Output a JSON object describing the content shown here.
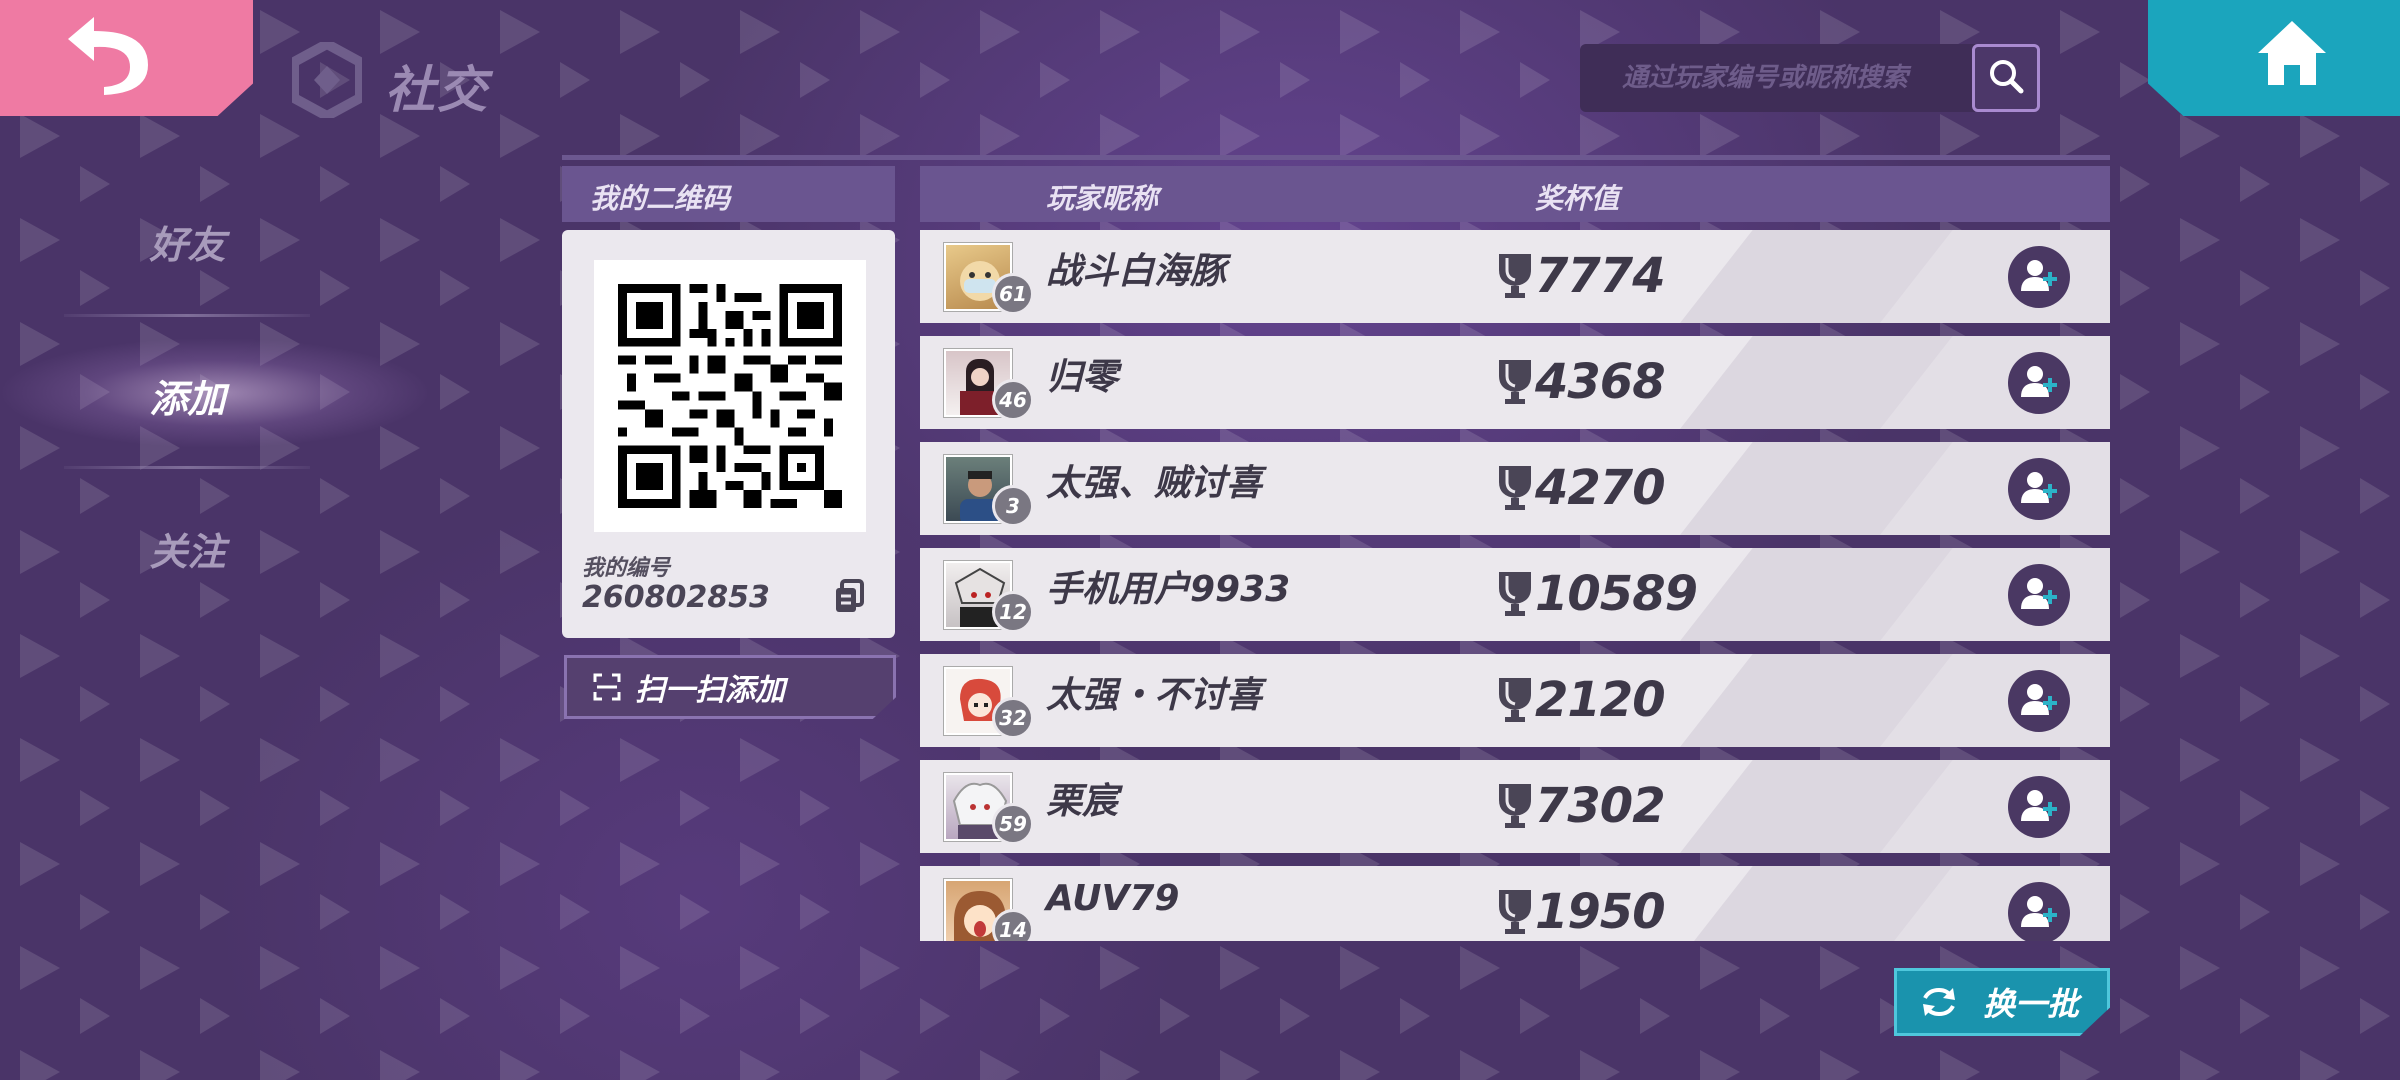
{
  "header": {
    "title": "社交",
    "search_placeholder": "通过玩家编号或昵称搜索"
  },
  "sidebar": {
    "items": [
      {
        "label": "好友"
      },
      {
        "label": "添加"
      },
      {
        "label": "关注"
      }
    ],
    "active": "添加"
  },
  "qr_panel": {
    "header": "我的二维码",
    "id_label": "我的编号",
    "id_value": "260802853",
    "scan_button": "扫一扫添加"
  },
  "list": {
    "col_name": "玩家昵称",
    "col_trophy": "奖杯值",
    "rows": [
      {
        "nickname": "战斗白海豚",
        "level": "61",
        "trophy": "7774"
      },
      {
        "nickname": "归零",
        "level": "46",
        "trophy": "4368"
      },
      {
        "nickname": "太强、贼讨喜",
        "level": "3",
        "trophy": "4270"
      },
      {
        "nickname": "手机用户9933",
        "level": "12",
        "trophy": "10589"
      },
      {
        "nickname": "太强・不讨喜",
        "level": "32",
        "trophy": "2120"
      },
      {
        "nickname": "栗宸",
        "level": "59",
        "trophy": "7302"
      },
      {
        "nickname": "AUV79",
        "level": "14",
        "trophy": "1950"
      }
    ]
  },
  "refresh_button": "换一批",
  "colors": {
    "background": "#4a3468",
    "back_button": "#ef7aa3",
    "home_button": "#1ba5bd",
    "refresh_button": "#1a93ad",
    "row_bg": "#ebe8ed",
    "add_button": "#4a3863",
    "add_plus": "#2bb3c8"
  },
  "icons": {
    "back": "back-arrow-icon",
    "home": "home-icon",
    "search": "search-icon",
    "copy": "copy-icon",
    "scan": "scan-icon",
    "trophy": "trophy-icon",
    "add_friend": "add-friend-icon",
    "refresh": "refresh-icon"
  }
}
